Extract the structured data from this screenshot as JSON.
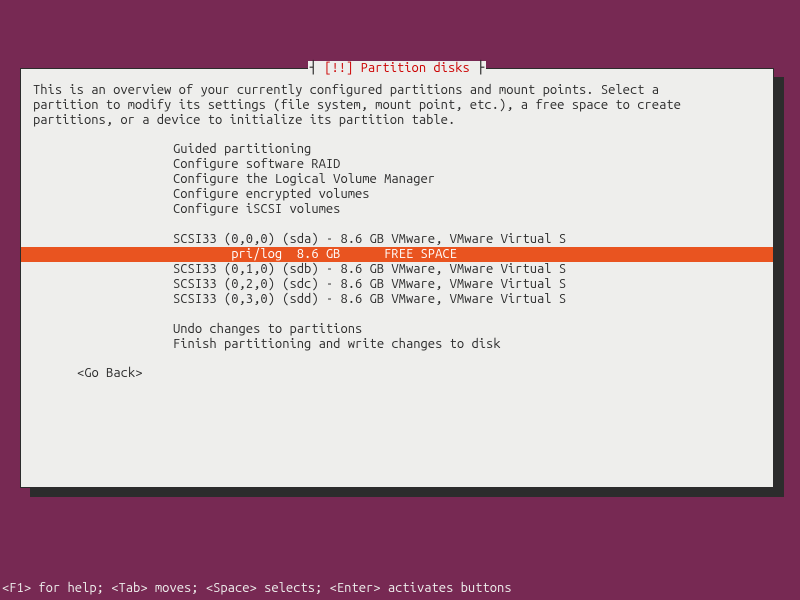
{
  "title": {
    "left_bracket": "┤ ",
    "warn": "[!!] ",
    "text": "Partition disks",
    "right_bracket": " ├"
  },
  "intro": "This is an overview of your currently configured partitions and mount points. Select a\npartition to modify its settings (file system, mount point, etc.), a free space to create\npartitions, or a device to initialize its partition table.",
  "menu": {
    "group1": [
      "Guided partitioning",
      "Configure software RAID",
      "Configure the Logical Volume Manager",
      "Configure encrypted volumes",
      "Configure iSCSI volumes"
    ],
    "disks": [
      "SCSI33 (0,0,0) (sda) - 8.6 GB VMware, VMware Virtual S",
      "        pri/log  8.6 GB      FREE SPACE                ",
      "SCSI33 (0,1,0) (sdb) - 8.6 GB VMware, VMware Virtual S",
      "SCSI33 (0,2,0) (sdc) - 8.6 GB VMware, VMware Virtual S",
      "SCSI33 (0,3,0) (sdd) - 8.6 GB VMware, VMware Virtual S"
    ],
    "selected_disk_index": 1,
    "group3": [
      "Undo changes to partitions",
      "Finish partitioning and write changes to disk"
    ]
  },
  "goback": "<Go Back>",
  "footer": "<F1> for help; <Tab> moves; <Space> selects; <Enter> activates buttons"
}
